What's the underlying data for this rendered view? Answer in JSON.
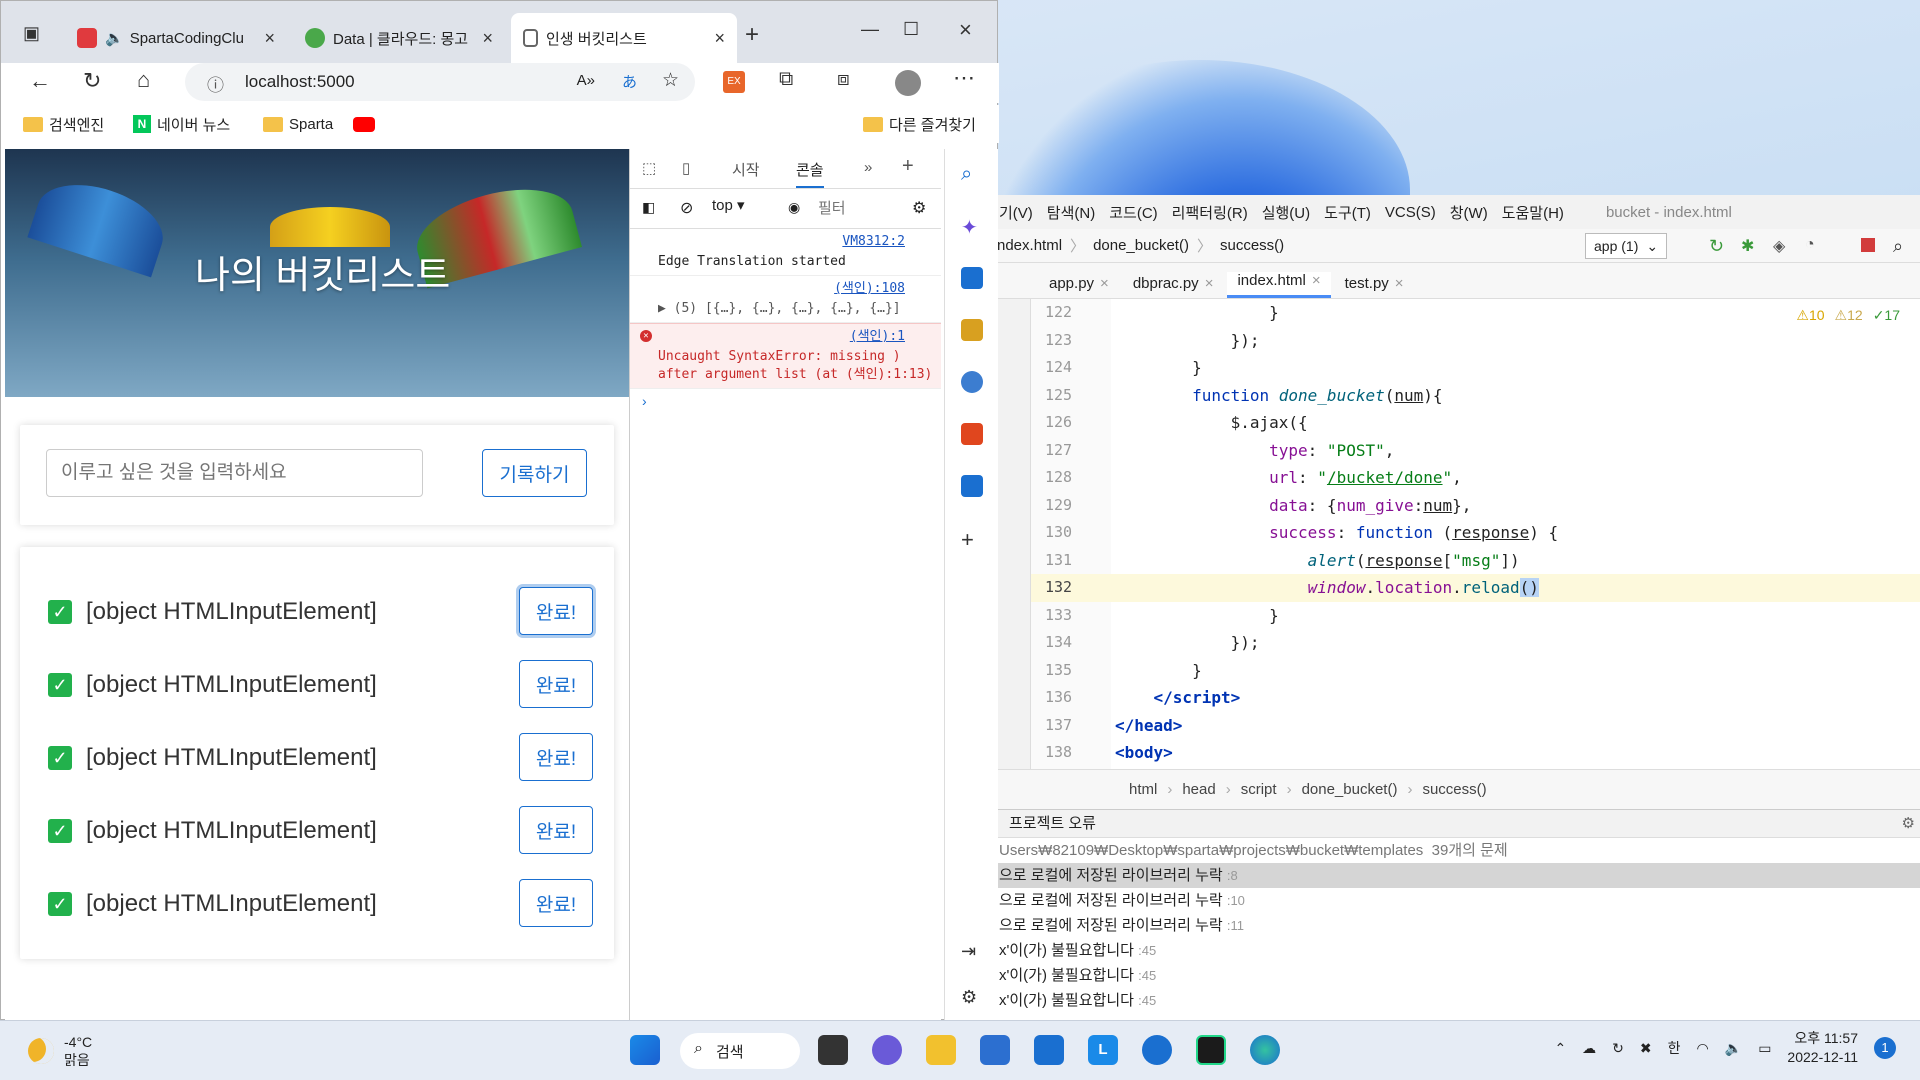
{
  "browser": {
    "tabs": [
      {
        "label": "SpartaCodingClu",
        "favicon_color": "#e03a3e"
      },
      {
        "label": "Data | 클라우드: 몽고",
        "favicon_color": "#4aa84a"
      },
      {
        "label": "인생 버킷리스트",
        "favicon_color": "#666666"
      }
    ],
    "url": "localhost:5000",
    "favorites": [
      "검색엔진",
      "네이버 뉴스",
      "Sparta"
    ],
    "other_favorites": "다른 즐겨찾기"
  },
  "page": {
    "title": "나의 버킷리스트",
    "input_placeholder": "이루고 싶은 것을 입력하세요",
    "record_button": "기록하기",
    "items": [
      {
        "text": "[object HTMLInputElement]",
        "button": "완료!"
      },
      {
        "text": "[object HTMLInputElement]",
        "button": "완료!"
      },
      {
        "text": "[object HTMLInputElement]",
        "button": "완료!"
      },
      {
        "text": "[object HTMLInputElement]",
        "button": "완료!"
      },
      {
        "text": "[object HTMLInputElement]",
        "button": "완료!"
      }
    ]
  },
  "devtools": {
    "tabs": [
      "시작",
      "콘솔"
    ],
    "context": "top",
    "filter_placeholder": "필터",
    "messages": [
      {
        "text": "Edge Translation started",
        "source": "VM8312:2"
      },
      {
        "text": "▶ (5) [{…}, {…}, {…}, {…}, {…}]",
        "source": "(색인):108"
      },
      {
        "text": "Uncaught SyntaxError: missing ) after argument list (at (색인):1:13)",
        "source": "(색인):1",
        "level": "error"
      }
    ]
  },
  "ide": {
    "menu": [
      "기(V)",
      "탐색(N)",
      "코드(C)",
      "리팩터링(R)",
      "실행(U)",
      "도구(T)",
      "VCS(S)",
      "창(W)",
      "도움말(H)"
    ],
    "window_title": "bucket - index.html",
    "nav": [
      "ndex.html",
      "done_bucket()",
      "success()"
    ],
    "run_config": "app (1)",
    "tabs": [
      "app.py",
      "dbprac.py",
      "index.html",
      "test.py"
    ],
    "active_tab": "index.html",
    "inspections": {
      "warnings": "10",
      "weak": "12",
      "ok": "17"
    },
    "line_numbers": [
      "122",
      "123",
      "124",
      "125",
      "126",
      "127",
      "128",
      "129",
      "130",
      "131",
      "132",
      "133",
      "134",
      "135",
      "136",
      "137",
      "138"
    ],
    "breadcrumb": [
      "html",
      "head",
      "script",
      "done_bucket()",
      "success()"
    ],
    "problems_title": "프로젝트 오류",
    "problems_path": "Users₩82109₩Desktop₩sparta₩projects₩bucket₩templates",
    "problems_count": "39개의 문제",
    "problems": [
      {
        "text": "으로 로컬에 저장된 라이브러리 누락",
        "line": ":8"
      },
      {
        "text": "으로 로컬에 저장된 라이브러리 누락",
        "line": ":10"
      },
      {
        "text": "으로 로컬에 저장된 라이브러리 누락",
        "line": ":11"
      },
      {
        "text": "x'이(가) 불필요합니다",
        "line": ":45"
      },
      {
        "text": "x'이(가) 불필요합니다",
        "line": ":45"
      },
      {
        "text": "x'이(가) 불필요합니다",
        "line": ":45"
      }
    ]
  },
  "taskbar": {
    "temperature": "-4°C",
    "weather": "맑음",
    "search": "검색",
    "ime": "한",
    "time": "오후 11:57",
    "date": "2022-12-11",
    "notifications": "1"
  }
}
